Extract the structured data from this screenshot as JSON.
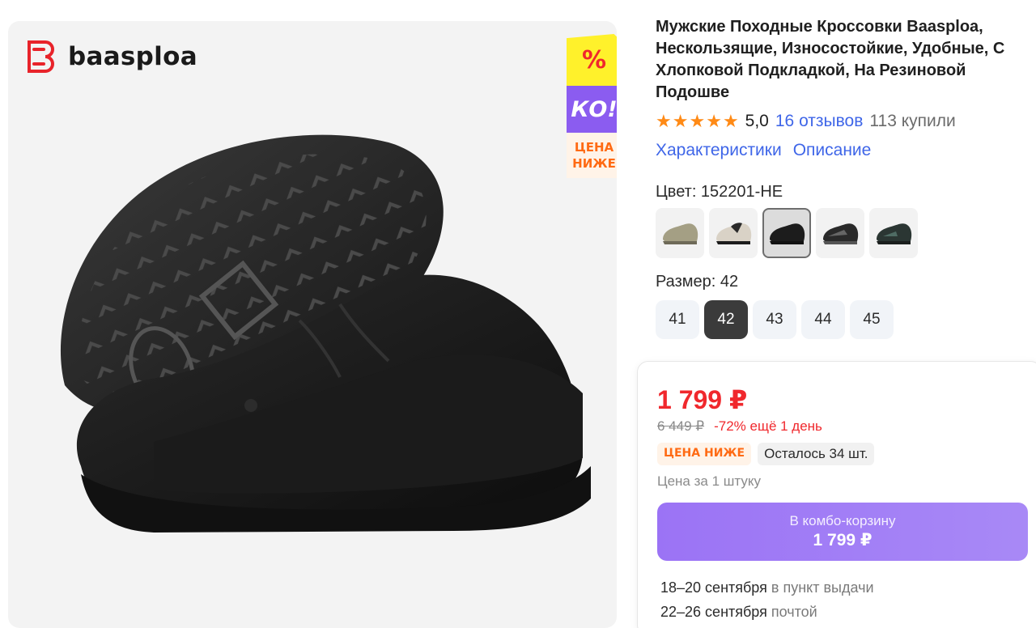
{
  "brand": {
    "name": "baasploa"
  },
  "promo": {
    "percent": "%",
    "ko": "КО!",
    "lower_line1": "ЦЕНА",
    "lower_line2": "НИЖЕ"
  },
  "product": {
    "title": "Мужские Походные Кроссовки Baasploa, Нескользящие, Износостойкие, Удобные, С Хлопковой Подкладкой, На Резиновой Подошве",
    "rating": "5,0",
    "stars": 5,
    "reviews": "16 отзывов",
    "bought": "113 купили",
    "tabs": [
      "Характеристики",
      "Описание"
    ]
  },
  "color": {
    "label": "Цвет: 152201-HE",
    "swatches": [
      {
        "name": "olive",
        "hex": "#a49f84",
        "selected": false
      },
      {
        "name": "beige-black",
        "hex": "#d9d2c6",
        "selected": false
      },
      {
        "name": "black",
        "hex": "#1c1c1c",
        "selected": true
      },
      {
        "name": "black-grey",
        "hex": "#2a2a2a",
        "selected": false
      },
      {
        "name": "black-teal",
        "hex": "#2b3633",
        "selected": false
      }
    ]
  },
  "size": {
    "label": "Размер: 42",
    "options": [
      "41",
      "42",
      "43",
      "44",
      "45"
    ],
    "selected": "42"
  },
  "price": {
    "current": "1 799 ₽",
    "old": "6 449 ₽",
    "discount": "-72% ещё 1 день",
    "badge_lower": "ЦЕНА НИЖЕ",
    "stock": "Осталось 34 шт.",
    "unit": "Цена за 1 штуку"
  },
  "cart_button": {
    "label": "В комбо-корзину",
    "price": "1 799 ₽"
  },
  "delivery": [
    {
      "date": "18–20 сентября",
      "where": "в пункт выдачи"
    },
    {
      "date": "22–26 сентября",
      "where": "почтой"
    }
  ],
  "colors": {
    "accent_red": "#f0282d",
    "link_blue": "#3f66e8",
    "star_orange": "#ff8a16",
    "cart_purple": "#9b73f5"
  }
}
